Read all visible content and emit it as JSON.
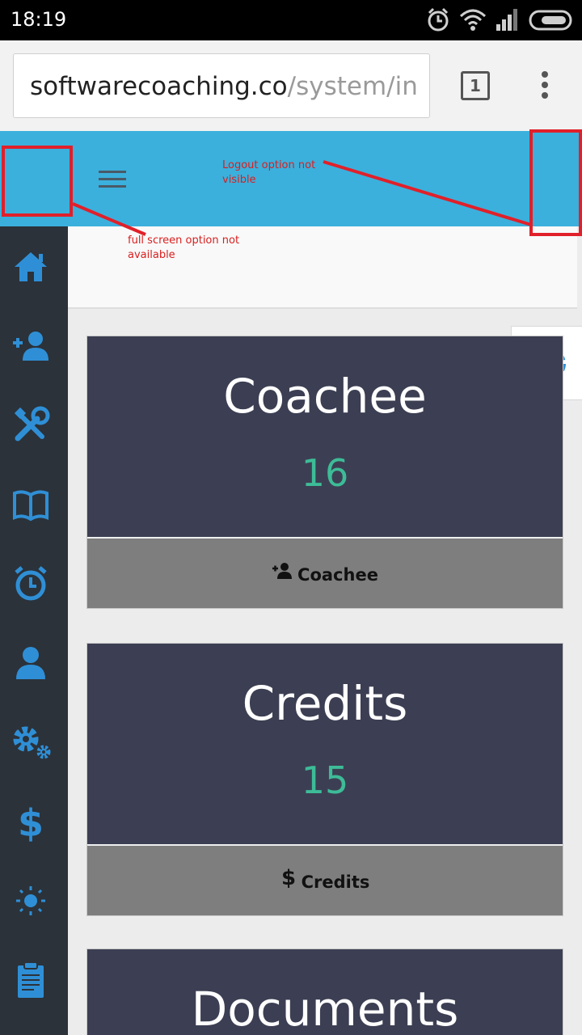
{
  "status_bar": {
    "time": "18:19",
    "icons": [
      "alarm-icon",
      "wifi-icon",
      "signal-icon",
      "battery-icon"
    ]
  },
  "browser": {
    "url_main": "softwarecoaching.co",
    "url_rest": "/system/in",
    "tab_count": "1",
    "icons": [
      "tab-switcher-icon",
      "overflow-menu-icon"
    ]
  },
  "header": {
    "bg_color": "#3bb0dc",
    "menu_icon": "hamburger-icon"
  },
  "sidebar": {
    "bg_color": "#2b323a",
    "icon_color": "#2f8fd6",
    "items": [
      {
        "icon": "home-icon"
      },
      {
        "icon": "add-user-icon"
      },
      {
        "icon": "tools-icon"
      },
      {
        "icon": "book-icon"
      },
      {
        "icon": "alarm-clock-icon"
      },
      {
        "icon": "user-icon"
      },
      {
        "icon": "settings-gears-icon"
      },
      {
        "icon": "dollar-icon"
      },
      {
        "icon": "sun-icon"
      },
      {
        "icon": "clipboard-icon"
      }
    ]
  },
  "settings_tab": {
    "icon": "gear-icon"
  },
  "cards": [
    {
      "title": "Coachee",
      "count": "16",
      "footer_label": "Coachee",
      "footer_icon": "add-user-icon"
    },
    {
      "title": "Credits",
      "count": "15",
      "footer_label": "Credits",
      "footer_icon": "dollar-icon"
    },
    {
      "title": "Documents"
    }
  ],
  "annotations": {
    "logout_note": "Logout option not\nvisible",
    "fullscreen_note": "full screen option not\navailable",
    "color": "#e0202a"
  },
  "colors": {
    "card_top": "#3c3f53",
    "card_count": "#3dbc97",
    "card_footer": "#7e7e7e"
  }
}
